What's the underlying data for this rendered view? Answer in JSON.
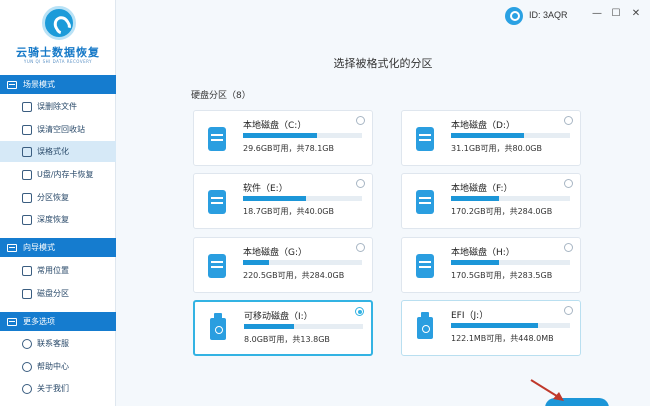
{
  "app": {
    "title": "云骑士数据恢复",
    "subtitle": "YUN QI SHI DATA RECOVERY"
  },
  "titlebar": {
    "user_id": "ID: 3AQR",
    "minimize": "—",
    "maximize": "☐",
    "close": "✕"
  },
  "sidebar": {
    "sections": [
      {
        "header": "场景模式",
        "items": [
          {
            "label": "误删除文件",
            "active": false
          },
          {
            "label": "误清空回收站",
            "active": false
          },
          {
            "label": "误格式化",
            "active": true
          },
          {
            "label": "U盘/内存卡恢复",
            "active": false
          },
          {
            "label": "分区恢复",
            "active": false
          },
          {
            "label": "深度恢复",
            "active": false
          }
        ]
      },
      {
        "header": "向导模式",
        "items": [
          {
            "label": "常用位置",
            "active": false
          },
          {
            "label": "磁盘分区",
            "active": false
          }
        ]
      },
      {
        "header": "更多选项",
        "items": [
          {
            "label": "联系客服",
            "active": false
          },
          {
            "label": "帮助中心",
            "active": false
          },
          {
            "label": "关于我们",
            "active": false
          }
        ]
      }
    ]
  },
  "main": {
    "title": "选择被格式化的分区",
    "partition_label": "硬盘分区（8）",
    "partitions": [
      {
        "name": "本地磁盘（C:）",
        "info": "29.6GB可用，共78.1GB",
        "used_fraction": 0.62,
        "type": "disk",
        "selected": false
      },
      {
        "name": "本地磁盘（D:）",
        "info": "31.1GB可用，共80.0GB",
        "used_fraction": 0.61,
        "type": "disk",
        "selected": false
      },
      {
        "name": "软件（E:）",
        "info": "18.7GB可用，共40.0GB",
        "used_fraction": 0.53,
        "type": "disk",
        "selected": false
      },
      {
        "name": "本地磁盘（F:）",
        "info": "170.2GB可用，共284.0GB",
        "used_fraction": 0.4,
        "type": "disk",
        "selected": false
      },
      {
        "name": "本地磁盘（G:）",
        "info": "220.5GB可用，共284.0GB",
        "used_fraction": 0.22,
        "type": "disk",
        "selected": false
      },
      {
        "name": "本地磁盘（H:）",
        "info": "170.5GB可用，共283.5GB",
        "used_fraction": 0.4,
        "type": "disk",
        "selected": false
      },
      {
        "name": "可移动磁盘（I:）",
        "info": "8.0GB可用，共13.8GB",
        "used_fraction": 0.42,
        "type": "usb",
        "selected": true
      },
      {
        "name": "EFI（J:）",
        "info": "122.1MB可用，共448.0MB",
        "used_fraction": 0.73,
        "type": "usb",
        "selected": false
      }
    ]
  },
  "colors": {
    "accent": "#1c96d8",
    "sidebar_header": "#157ccf",
    "selected_border": "#33b3e3",
    "arrow": "#c0392b"
  }
}
